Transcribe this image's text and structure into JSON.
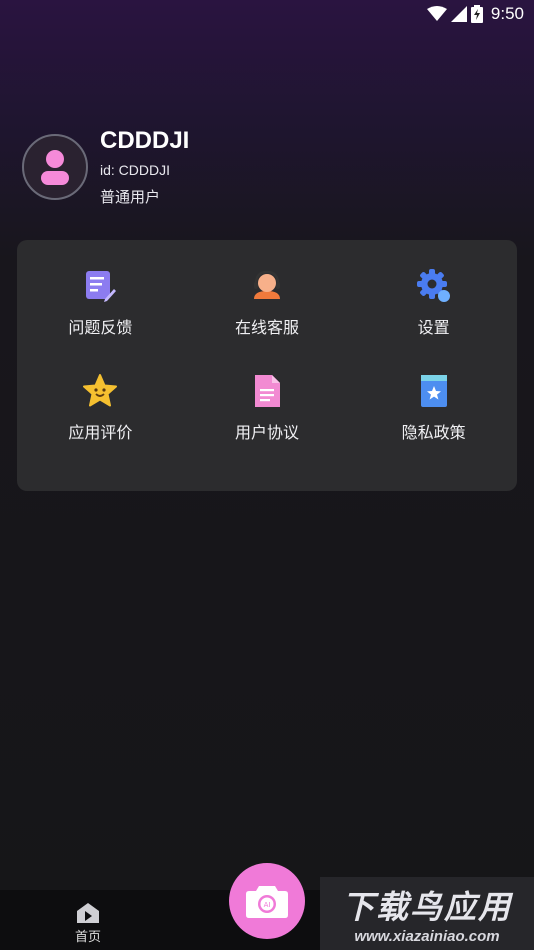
{
  "status_bar": {
    "time": "9:50"
  },
  "profile": {
    "username": "CDDDJI",
    "user_id": "id: CDDDJI",
    "user_type": "普通用户"
  },
  "menu": {
    "items": [
      {
        "label": "问题反馈",
        "icon": "feedback-icon"
      },
      {
        "label": "在线客服",
        "icon": "customer-service-icon"
      },
      {
        "label": "设置",
        "icon": "settings-icon"
      },
      {
        "label": "应用评价",
        "icon": "star-rating-icon"
      },
      {
        "label": "用户协议",
        "icon": "document-icon"
      },
      {
        "label": "隐私政策",
        "icon": "bookmark-icon"
      }
    ]
  },
  "bottom_nav": {
    "home_label": "首页"
  },
  "watermark": {
    "title": "下载鸟应用",
    "url": "www.xiazainiao.com"
  },
  "colors": {
    "accent": "#f07ad8",
    "card": "#2c2c2e"
  }
}
